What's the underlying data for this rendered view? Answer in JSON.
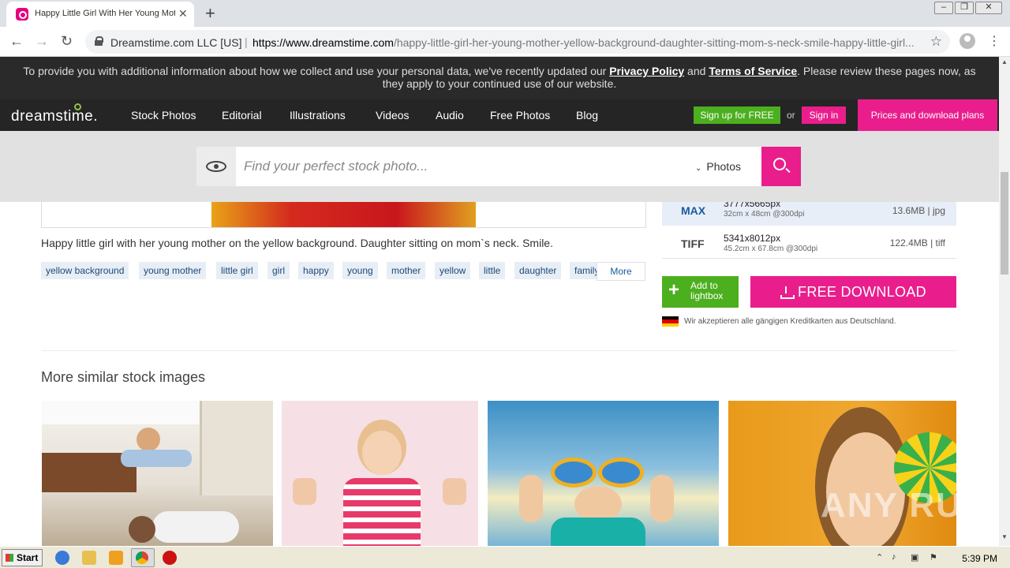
{
  "browser": {
    "tab_title": "Happy Little Girl With Her Young Mother Yellow Background Daughter",
    "tab_close": "✕",
    "new_tab": "+",
    "win_min": "–",
    "win_restore": "❐",
    "win_close": "✕",
    "cert_org": "Dreamstime.com LLC [US]",
    "url_sep": "|",
    "url_scheme_host": "https://www.dreamstime.com",
    "url_path": "/happy-little-girl-her-young-mother-yellow-background-daughter-sitting-mom-s-neck-smile-happy-little-girl...",
    "back": "←",
    "forward": "→",
    "reload": "↻",
    "star": "☆",
    "menu": "⋮"
  },
  "notice": {
    "part1": "To provide you with additional information about how we collect and use your personal data, we've recently updated our ",
    "privacy_link": "Privacy Policy",
    "part2": " and ",
    "terms_link": "Terms of Service",
    "part3": ". Please review these pages now, as they apply to your continued use of our website."
  },
  "header": {
    "logo": "dreamstime.",
    "nav": [
      "Stock Photos",
      "Editorial",
      "Illustrations",
      "Videos",
      "Audio",
      "Free Photos",
      "Blog"
    ],
    "signup": "Sign up for FREE",
    "or": "or",
    "signin": "Sign in",
    "prices": "Prices and download plans"
  },
  "search": {
    "placeholder": "Find your perfect stock photo...",
    "type": "Photos",
    "chevron": "⌄"
  },
  "image": {
    "description": "Happy little girl with her young mother on the yellow background. Daughter sitting on mom`s neck. Smile.",
    "tags": [
      "yellow background",
      "young mother",
      "little girl",
      "girl",
      "happy",
      "young",
      "mother",
      "yellow",
      "little",
      "daughter",
      "family"
    ],
    "more": "More"
  },
  "sizes": {
    "max": {
      "label": "MAX",
      "dim": "3777x5665px",
      "sub": "32cm x 48cm @300dpi",
      "file": "13.6MB | jpg"
    },
    "tiff": {
      "label": "TIFF",
      "dim": "5341x8012px",
      "sub": "45.2cm x 67.8cm @300dpi",
      "file": "122.4MB | tiff"
    }
  },
  "actions": {
    "lightbox_plus": "+",
    "lightbox": "Add to lightbox",
    "download": "FREE DOWNLOAD",
    "cc_note": "Wir akzeptieren alle gängigen Kreditkarten aus Deutschland."
  },
  "similar": {
    "title": "More similar stock images"
  },
  "watermark": "ANY RUN",
  "taskbar": {
    "start": "Start",
    "clock": "5:39 PM"
  },
  "colors": {
    "brand_pink": "#e91e8c",
    "brand_green": "#4caf1e",
    "header_dark": "#252525",
    "tag_text": "#1a4a7a"
  }
}
